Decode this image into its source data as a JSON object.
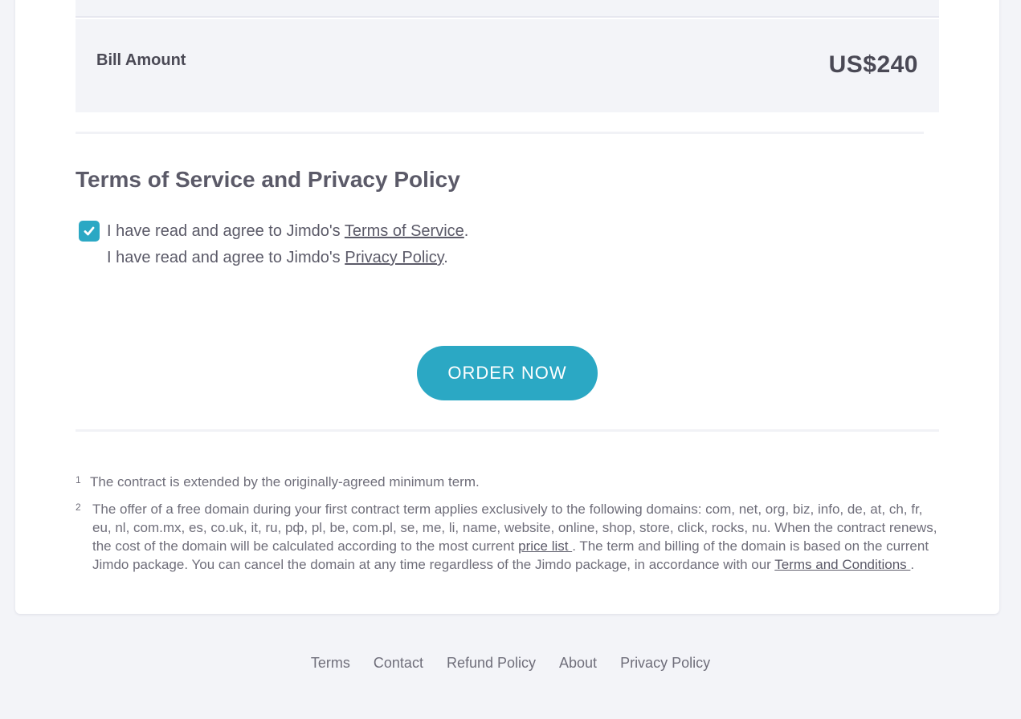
{
  "bill": {
    "label": "Bill Amount",
    "amount": "US$240"
  },
  "tos": {
    "title": "Terms of Service and Privacy Policy",
    "checkbox_checked": true,
    "line1_prefix": "I have read and agree to Jimdo's ",
    "line1_link": "Terms of Service",
    "line1_suffix": ".",
    "line2_prefix": "I have read and agree to Jimdo's ",
    "line2_link": "Privacy Policy",
    "line2_suffix": "."
  },
  "order_button": {
    "label": "ORDER NOW",
    "color": "#2ba8c4"
  },
  "footnotes": [
    {
      "num": "1",
      "text": "The contract is extended by the originally-agreed minimum term."
    },
    {
      "num": "2",
      "text_part1": "The offer of a free domain during your first contract term applies exclusively to the following domains: com, net, org, biz, info, de, at, ch, fr, eu, nl, com.mx, es, co.uk, it, ru, рф, pl, be, com.pl, se, me, li, name, website, online, shop, store, click, rocks, nu. When the contract renews, the cost of the domain will be calculated according to the most current ",
      "link1": "price list ",
      "text_part2": ". The term and billing of the domain is based on the current Jimdo package. You can cancel the domain at any time regardless of the Jimdo package, in accordance with our ",
      "link2": "Terms and Conditions ",
      "text_part3": "."
    }
  ],
  "footer": {
    "links": [
      "Terms",
      "Contact",
      "Refund Policy",
      "About",
      "Privacy Policy"
    ]
  }
}
